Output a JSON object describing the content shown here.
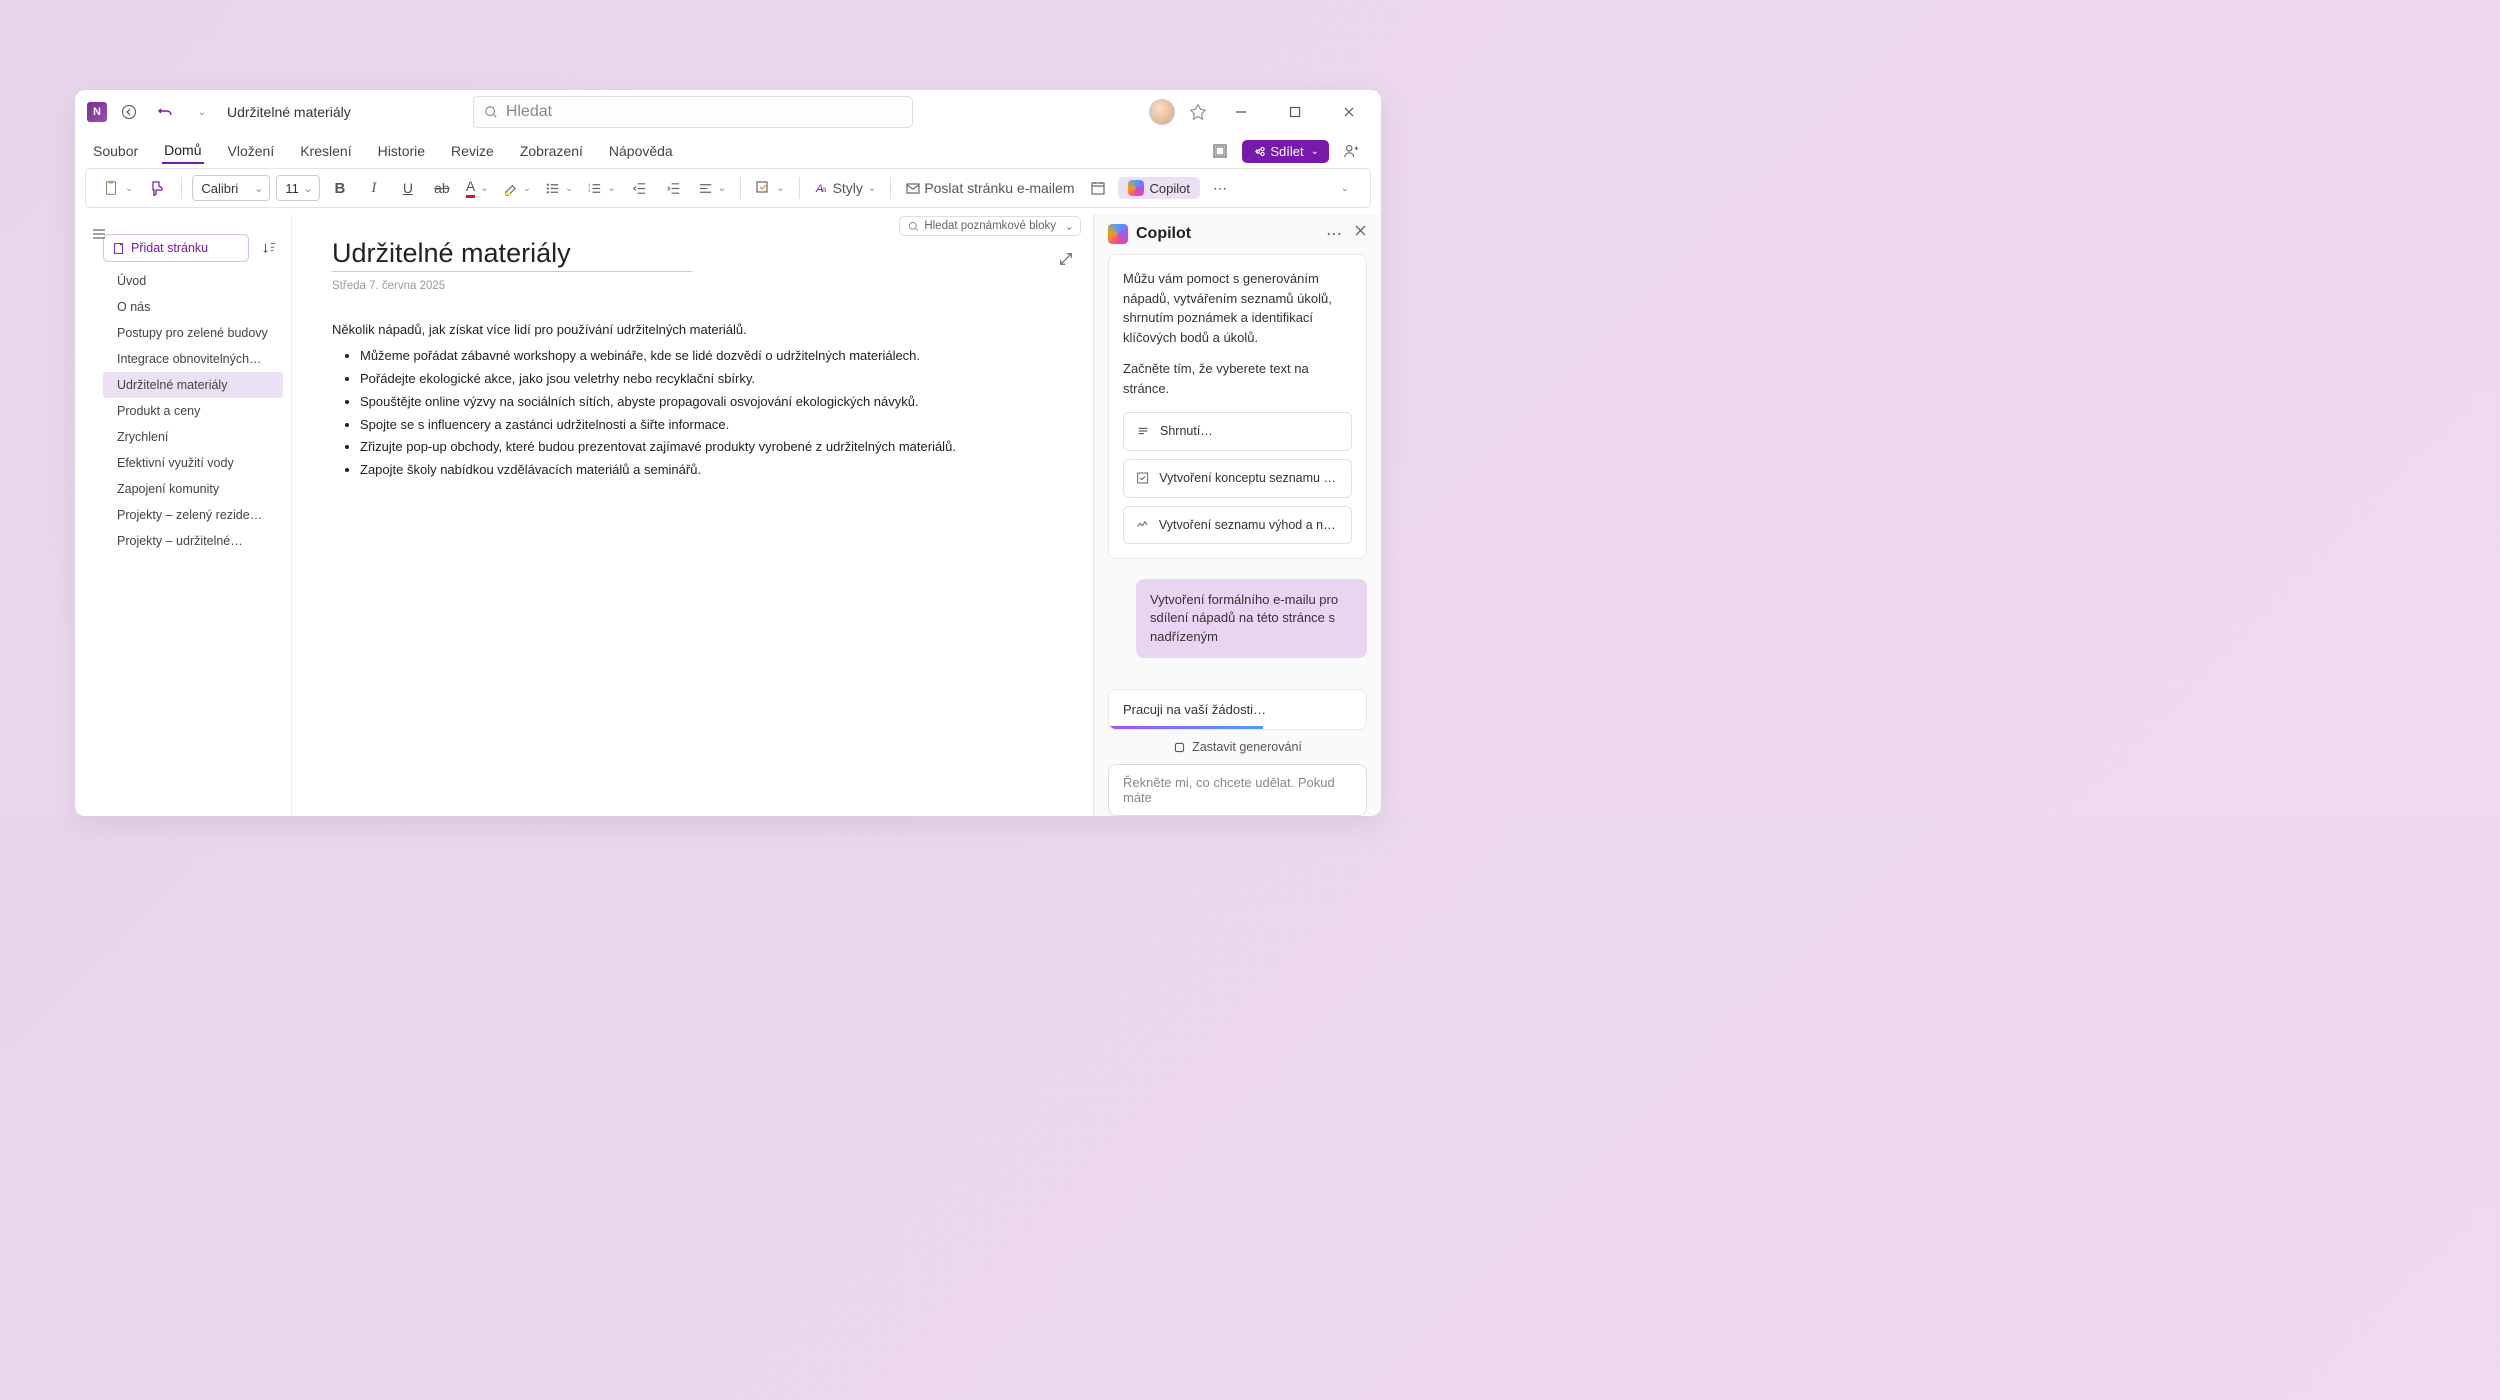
{
  "titlebar": {
    "doc_title": "Udržitelné materiály",
    "search_placeholder": "Hledat"
  },
  "menubar": {
    "tabs": [
      "Soubor",
      "Domů",
      "Vložení",
      "Kreslení",
      "Historie",
      "Revize",
      "Zobrazení",
      "Nápověda"
    ],
    "active_index": 1,
    "share": "Sdílet"
  },
  "ribbon": {
    "font_name": "Calibri",
    "font_size": "11",
    "styles": "Styly",
    "send_email": "Poslat stránku e-mailem",
    "copilot": "Copilot"
  },
  "search_notebooks": "Hledat poznámkové bloky",
  "sidebar": {
    "add_page": "Přidat stránku",
    "pages": [
      "Úvod",
      "O nás",
      "Postupy pro zelené budovy",
      "Integrace obnovitelných…",
      "Udržitelné materiály",
      "Produkt a ceny",
      "Zrychlení",
      "Efektivní využití vody",
      "Zapojení komunity",
      "Projekty – zelený rezide…",
      "Projekty – udržitelné…"
    ],
    "active_index": 4
  },
  "content": {
    "title": "Udržitelné materiály",
    "date": "Středa 7. června 2025",
    "intro": "Několik nápadů, jak získat více lidí pro používání udržitelných materiálů.",
    "bullets": [
      "Můžeme pořádat zábavné workshopy a webináře, kde se lidé dozvědí o udržitelných materiálech.",
      "Pořádejte ekologické akce, jako jsou veletrhy nebo recyklační sbírky.",
      "Spouštějte online výzvy na sociálních sítích, abyste propagovali osvojování ekologických návyků.",
      "Spojte se s influencery a zastánci udržitelnosti a šiřte informace.",
      "Zřizujte pop-up obchody, které budou prezentovat zajímavé produkty vyrobené z udržitelných materiálů.",
      "Zapojte školy nabídkou vzdělávacích materiálů a seminářů."
    ]
  },
  "copilot": {
    "title": "Copilot",
    "intro1": "Můžu vám pomoct s generováním nápadů, vytvářením seznamů úkolů, shrnutím poznámek a identifikací klíčových bodů a úkolů.",
    "intro2": "Začněte tím, že vyberete text na stránce.",
    "suggestions": [
      "Shrnutí…",
      "Vytvoření konceptu seznamu úk…",
      "Vytvoření seznamu výhod a nevý…"
    ],
    "user_message": "Vytvoření formálního e-mailu pro sdílení nápadů na této stránce s nadřízeným",
    "working": "Pracuji na vaší žádosti…",
    "stop": "Zastavit generování",
    "input_placeholder": "Řekněte mi, co chcete udělat. Pokud máte"
  }
}
